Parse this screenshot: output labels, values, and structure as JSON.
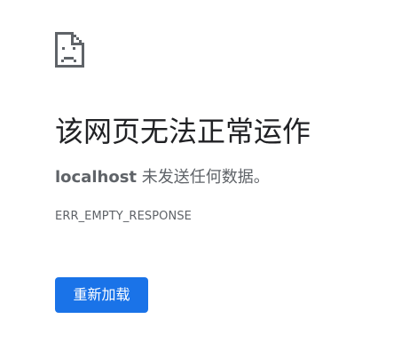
{
  "icon": "sad-page-icon",
  "title": "该网页无法正常运作",
  "message": {
    "host": "localhost",
    "text": " 未发送任何数据。"
  },
  "error_code": "ERR_EMPTY_RESPONSE",
  "reload_button": {
    "label": "重新加载",
    "color": "#1a73e8"
  }
}
